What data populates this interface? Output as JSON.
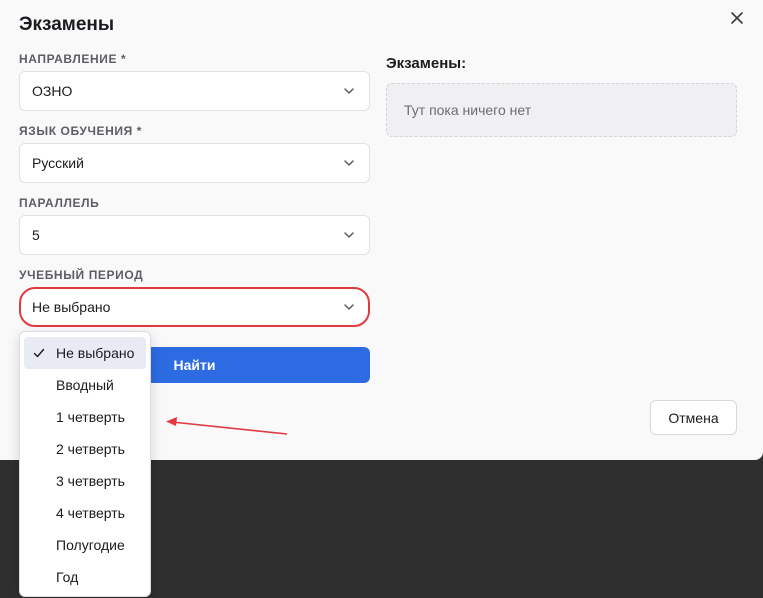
{
  "modal": {
    "title": "Экзамены",
    "close_icon": "close-icon"
  },
  "form": {
    "direction": {
      "label": "НАПРАВЛЕНИЕ *",
      "value": "ОЗНО"
    },
    "language": {
      "label": "ЯЗЫК ОБУЧЕНИЯ *",
      "value": "Русский"
    },
    "parallel": {
      "label": "ПАРАЛЛЕЛЬ",
      "value": "5"
    },
    "period": {
      "label": "УЧЕБНЫЙ ПЕРИОД",
      "value": "Не выбрано"
    },
    "find_label": "Найти"
  },
  "exams": {
    "heading": "Экзамены:",
    "empty_text": "Тут пока ничего нет"
  },
  "cancel_label": "Отмена",
  "period_options": [
    {
      "label": "Не выбрано",
      "selected": true
    },
    {
      "label": "Вводный",
      "selected": false
    },
    {
      "label": "1 четверть",
      "selected": false
    },
    {
      "label": "2 четверть",
      "selected": false
    },
    {
      "label": "3 четверть",
      "selected": false
    },
    {
      "label": "4 четверть",
      "selected": false
    },
    {
      "label": "Полугодие",
      "selected": false
    },
    {
      "label": "Год",
      "selected": false
    }
  ],
  "colors": {
    "accent": "#2d6be3",
    "highlight": "#e0393e",
    "backdrop": "#2f2f2f"
  }
}
